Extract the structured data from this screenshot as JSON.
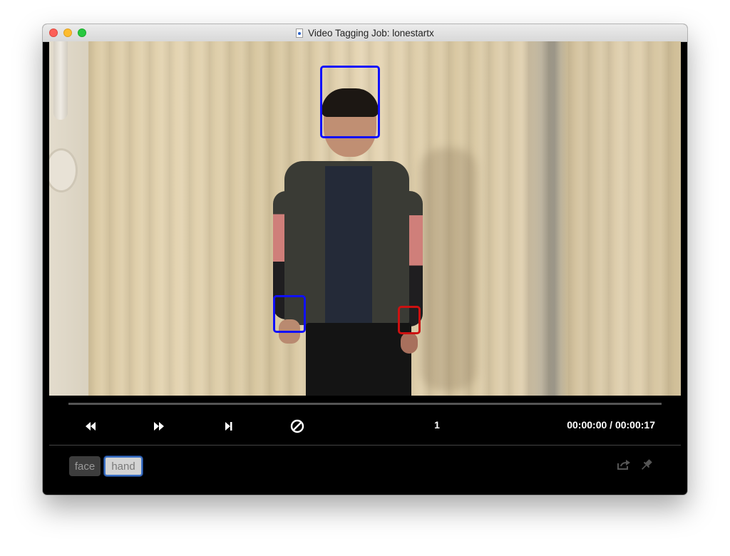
{
  "window": {
    "title": "Video Tagging Job: lonestartx"
  },
  "video": {
    "boxes": [
      {
        "label": "face",
        "color": "#1010ff"
      },
      {
        "label": "hand",
        "color": "#1010ff"
      },
      {
        "label": "hand",
        "color": "#cc1111"
      }
    ]
  },
  "controls": {
    "rewind_icon": "rewind-icon",
    "fast_forward_icon": "fast-forward-icon",
    "step_forward_icon": "step-forward-icon",
    "clear_icon": "no-entry-icon",
    "frame": "1",
    "time": "00:00:00 / 00:00:17",
    "progress": 0
  },
  "tags": [
    {
      "label": "face",
      "selected": false
    },
    {
      "label": "hand",
      "selected": true
    }
  ],
  "actions": {
    "export_icon": "export-icon",
    "pin_icon": "pin-icon"
  },
  "colors": {
    "selected_box": "#1010ff",
    "unselected_box": "#cc1111",
    "tag_selected_border": "#3b71c6"
  }
}
